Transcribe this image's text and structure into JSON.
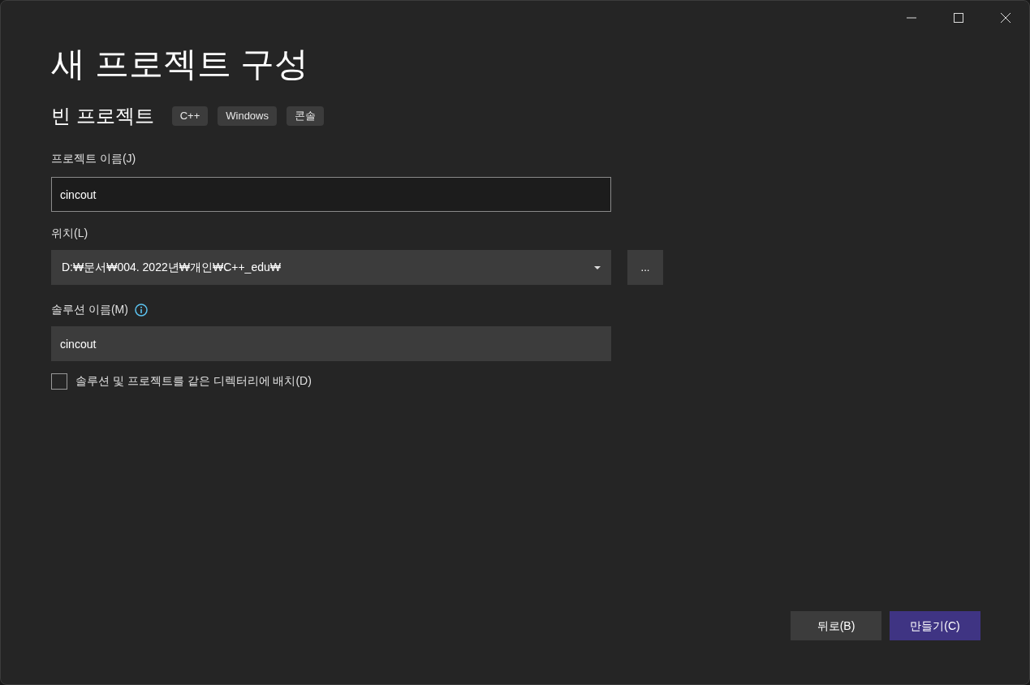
{
  "title": "새 프로젝트 구성",
  "template": {
    "name": "빈 프로젝트",
    "tags": [
      "C++",
      "Windows",
      "콘솔"
    ]
  },
  "project_name": {
    "label": "프로젝트 이름(J)",
    "value": "cincout"
  },
  "location": {
    "label": "위치(L)",
    "value": "D:₩문서₩004. 2022년₩개인₩C++_edu₩",
    "browse": "..."
  },
  "solution_name": {
    "label": "솔루션 이름(M)",
    "value": "cincout"
  },
  "same_directory": {
    "label": "솔루션 및 프로젝트를 같은 디렉터리에 배치(D)",
    "checked": false
  },
  "buttons": [
    {
      "label": "뒤로(B)",
      "kind": "secondary"
    },
    {
      "label": "만들기(C)",
      "kind": "primary"
    }
  ]
}
